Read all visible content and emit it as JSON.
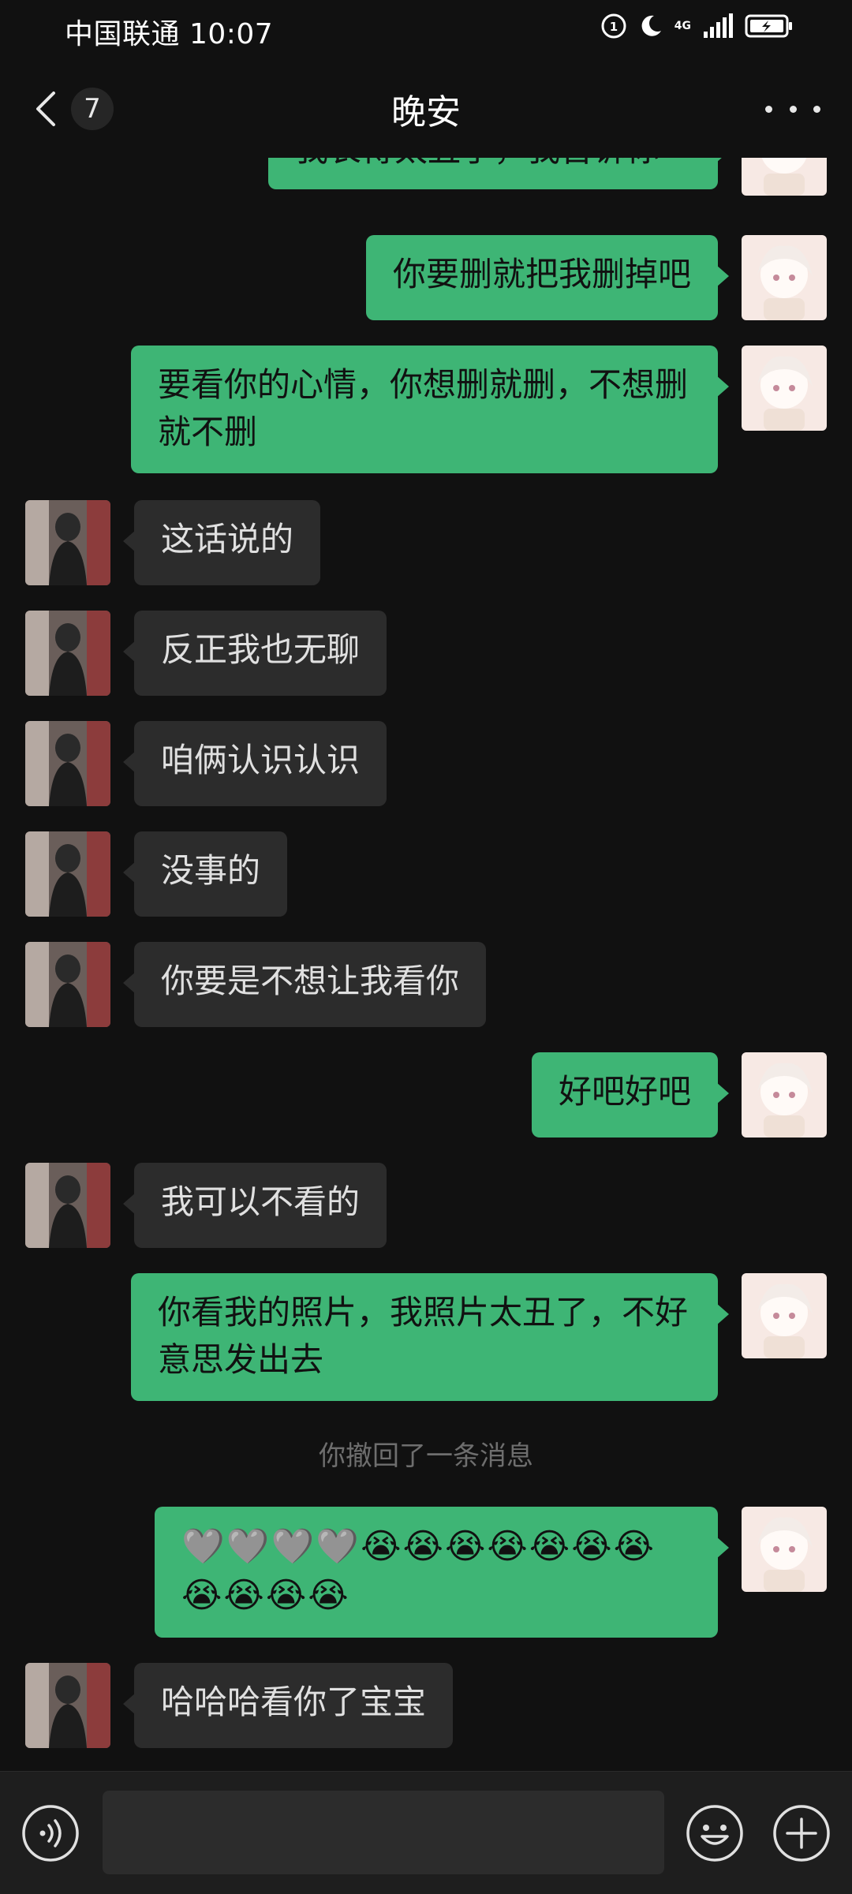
{
  "status_bar": {
    "carrier_time": "中国联通 10:07",
    "network": "4G"
  },
  "header": {
    "unread_count": "7",
    "title": "晚安"
  },
  "messages": [
    {
      "side": "me",
      "text": "我长得太丑了，我告诉你"
    },
    {
      "side": "me",
      "text": "你要删就把我删掉吧"
    },
    {
      "side": "me",
      "text": "要看你的心情，你想删就删，不想删就不删"
    },
    {
      "side": "other",
      "text": "这话说的"
    },
    {
      "side": "other",
      "text": "反正我也无聊"
    },
    {
      "side": "other",
      "text": "咱俩认识认识"
    },
    {
      "side": "other",
      "text": "没事的"
    },
    {
      "side": "other",
      "text": "你要是不想让我看你"
    },
    {
      "side": "me",
      "text": "好吧好吧"
    },
    {
      "side": "other",
      "text": "我可以不看的"
    },
    {
      "side": "me",
      "text": "你看我的照片，我照片太丑了，不好意思发出去"
    },
    {
      "side": "system",
      "text": "你撤回了一条消息"
    },
    {
      "side": "me",
      "text": "🩶🩶🩶🩶😭😭😭😭😭😭😭😭😭😭😭"
    },
    {
      "side": "other",
      "text": "哈哈哈看你了宝宝"
    }
  ],
  "input_bar": {
    "placeholder": "",
    "value": ""
  },
  "icons": {
    "back": "chevron-left-icon",
    "more": "more-dots-icon",
    "voice": "voice-icon",
    "emoji": "emoji-icon",
    "plus": "plus-icon"
  },
  "colors": {
    "background": "#111111",
    "my_bubble": "#3eb575",
    "other_bubble": "#2c2c2c",
    "system_text": "#6e6e6e"
  }
}
